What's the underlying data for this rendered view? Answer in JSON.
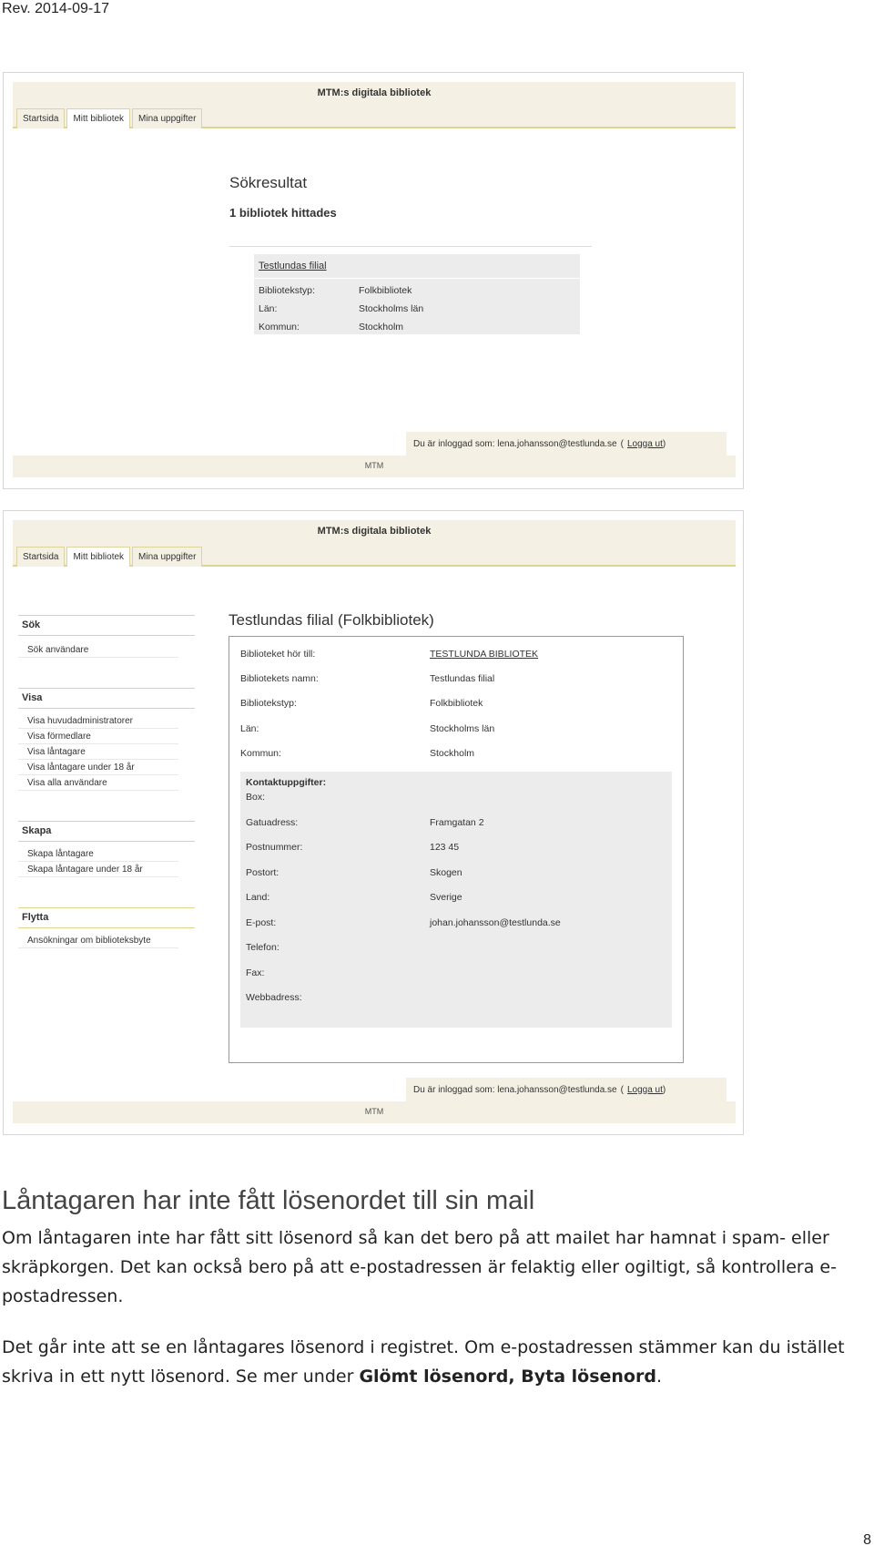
{
  "rev": "Rev. 2014-09-17",
  "app": {
    "title": "MTM:s digitala bibliotek",
    "tabs": [
      "Startsida",
      "Mitt bibliotek",
      "Mina uppgifter"
    ],
    "footer": "MTM",
    "login_prefix": "Du är inloggad som: lena.johansson@testlunda.se",
    "logout_open": "(",
    "logout": "Logga ut",
    "logout_close": ")"
  },
  "screen1": {
    "heading": "Sökresultat",
    "count": "1 bibliotek hittades",
    "result_link": "Testlundas filial",
    "fields": [
      {
        "label": "Bibliotekstyp:",
        "value": "Folkbibliotek"
      },
      {
        "label": "Län:",
        "value": "Stockholms län"
      },
      {
        "label": "Kommun:",
        "value": "Stockholm"
      }
    ]
  },
  "screen2": {
    "sidebar": [
      {
        "head": "Sök",
        "items": [
          "Sök användare"
        ]
      },
      {
        "head": "Visa",
        "items": [
          "Visa huvudadministratorer",
          "Visa förmedlare",
          "Visa låntagare",
          "Visa låntagare under 18 år",
          "Visa alla användare"
        ]
      },
      {
        "head": "Skapa",
        "items": [
          "Skapa låntagare",
          "Skapa låntagare under 18 år"
        ]
      },
      {
        "head": "Flytta",
        "items": [
          "Ansökningar om biblioteksbyte"
        ]
      }
    ],
    "title": "Testlundas filial (Folkbibliotek)",
    "top_fields": [
      {
        "label": "Biblioteket hör till:",
        "value": "TESTLUNDA BIBLIOTEK"
      },
      {
        "label": "Bibliotekets namn:",
        "value": "Testlundas filial"
      },
      {
        "label": "Bibliotekstyp:",
        "value": "Folkbibliotek"
      },
      {
        "label": "Län:",
        "value": "Stockholms län"
      },
      {
        "label": "Kommun:",
        "value": "Stockholm"
      }
    ],
    "contact_heading": "Kontaktuppgifter:",
    "contact_fields": [
      {
        "label": "Box:",
        "value": ""
      },
      {
        "label": "Gatuadress:",
        "value": "Framgatan 2"
      },
      {
        "label": "Postnummer:",
        "value": "123 45"
      },
      {
        "label": "Postort:",
        "value": "Skogen"
      },
      {
        "label": "Land:",
        "value": "Sverige"
      },
      {
        "label": "E-post:",
        "value": "johan.johansson@testlunda.se"
      },
      {
        "label": "Telefon:",
        "value": ""
      },
      {
        "label": "Fax:",
        "value": ""
      },
      {
        "label": "Webbadress:",
        "value": ""
      }
    ]
  },
  "heading": "Låntagaren har inte fått lösenordet till sin mail",
  "para1": "Om låntagaren inte har fått sitt lösenord så kan det bero på att mailet har hamnat i spam- eller skräpkorgen. Det kan också bero på att e-postadressen är felaktig eller ogiltigt, så kontrollera e-postadressen.",
  "para2_pre": "Det går inte att se en låntagares lösenord i registret. Om e-postadressen stämmer kan du istället skriva in ett nytt lösenord. Se mer under ",
  "para2_bold": "Glömt lösenord, Byta lösenord",
  "para2_post": ".",
  "page_number": "8"
}
